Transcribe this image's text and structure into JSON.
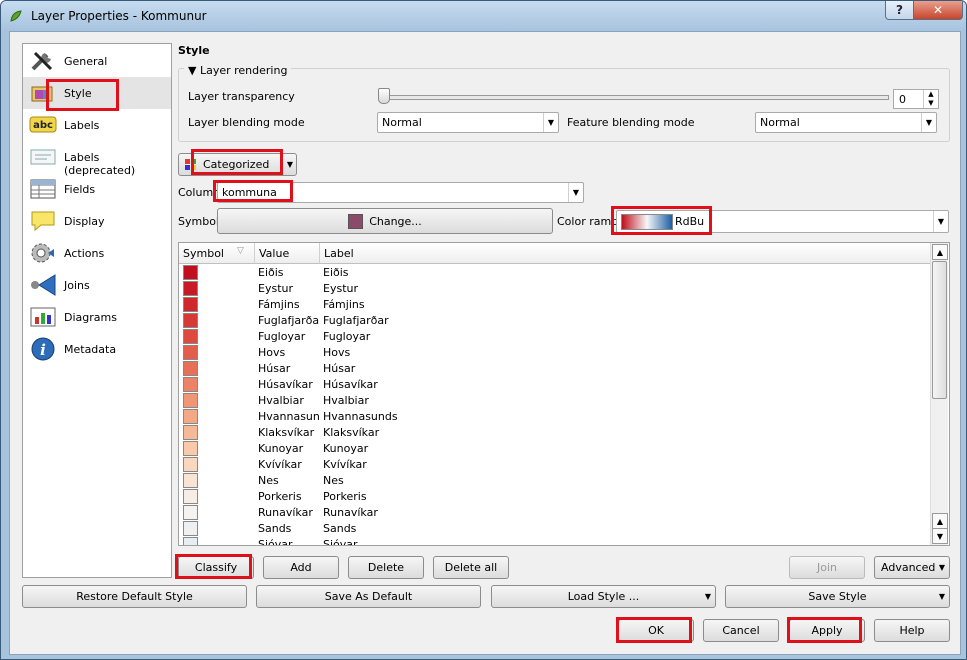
{
  "window": {
    "title": "Layer Properties - Kommunur",
    "help_glyph": "?",
    "close_glyph": "✕"
  },
  "sidebar": {
    "items": [
      {
        "label": "General",
        "icon": "tools-icon"
      },
      {
        "label": "Style",
        "icon": "style-icon"
      },
      {
        "label": "Labels",
        "icon": "abc-labels-icon",
        "badge": "abc"
      },
      {
        "label": "Labels (deprecated)",
        "icon": "labels-deprecated-icon"
      },
      {
        "label": "Fields",
        "icon": "fields-table-icon"
      },
      {
        "label": "Display",
        "icon": "speech-bubble-icon"
      },
      {
        "label": "Actions",
        "icon": "gear-icon"
      },
      {
        "label": "Joins",
        "icon": "joins-icon"
      },
      {
        "label": "Diagrams",
        "icon": "diagrams-icon"
      },
      {
        "label": "Metadata",
        "icon": "info-icon",
        "badge": "i"
      }
    ]
  },
  "style": {
    "title": "Style",
    "layer_rendering": {
      "group_label": "Layer rendering",
      "transparency_label": "Layer transparency",
      "transparency_value": "0",
      "transparency_level": 0,
      "blending_label": "Layer blending mode",
      "blending_value": "Normal",
      "feature_blending_label": "Feature blending mode",
      "feature_blending_value": "Normal"
    },
    "renderer": "Categorized",
    "column_label": "Column",
    "column_value": "kommuna",
    "symbol_label": "Symbol",
    "change_label": "Change...",
    "symbol_color": "#8b4a6a",
    "color_ramp_label": "Color ramp",
    "color_ramp_value": "RdBu",
    "table": {
      "headers": [
        "Symbol",
        "Value",
        "Label"
      ],
      "rows": [
        {
          "value": "Eiðis",
          "label": "Eiðis",
          "color": "#c0101e"
        },
        {
          "value": "Eystur",
          "label": "Eystur",
          "color": "#c81a26"
        },
        {
          "value": "Fámjins",
          "label": "Fámjins",
          "color": "#d0272d"
        },
        {
          "value": "Fuglafjarðar",
          "label": "Fuglafjarðar",
          "color": "#d73a36"
        },
        {
          "value": "Fugloyar",
          "label": "Fugloyar",
          "color": "#dd4b40"
        },
        {
          "value": "Hovs",
          "label": "Hovs",
          "color": "#e25d4c"
        },
        {
          "value": "Húsar",
          "label": "Húsar",
          "color": "#e77059"
        },
        {
          "value": "Húsavíkar",
          "label": "Húsavíkar",
          "color": "#ec8367"
        },
        {
          "value": "Hvalbiar",
          "label": "Hvalbiar",
          "color": "#f09676"
        },
        {
          "value": "Hvannasunds",
          "label": "Hvannasunds",
          "color": "#f3a886"
        },
        {
          "value": "Klaksvíkar",
          "label": "Klaksvíkar",
          "color": "#f6b998"
        },
        {
          "value": "Kunoyar",
          "label": "Kunoyar",
          "color": "#f8c9ab"
        },
        {
          "value": "Kvívíkar",
          "label": "Kvívíkar",
          "color": "#f9d7bf"
        },
        {
          "value": "Nes",
          "label": "Nes",
          "color": "#f9e3d3"
        },
        {
          "value": "Porkeris",
          "label": "Porkeris",
          "color": "#f8ece6"
        },
        {
          "value": "Runavíkar",
          "label": "Runavíkar",
          "color": "#f5f3f1"
        },
        {
          "value": "Sands",
          "label": "Sands",
          "color": "#eef1f4"
        },
        {
          "value": "Sjóvar",
          "label": "Sjóvar",
          "color": "#e6edf3"
        }
      ]
    },
    "buttons": {
      "classify": "Classify",
      "add": "Add",
      "delete": "Delete",
      "delete_all": "Delete all",
      "join": "Join",
      "advanced": "Advanced"
    }
  },
  "footer": {
    "restore_default": "Restore Default Style",
    "save_default": "Save As Default",
    "load_style": "Load Style ...",
    "save_style": "Save Style"
  },
  "dialog": {
    "ok": "OK",
    "cancel": "Cancel",
    "apply": "Apply",
    "help": "Help"
  },
  "colors": {
    "highlight": "#e0101a",
    "titlebar": "#b5cee6",
    "ramp_start": "#c0101e",
    "ramp_mid": "#f7f7f7",
    "ramp_end": "#1d5fa8"
  }
}
